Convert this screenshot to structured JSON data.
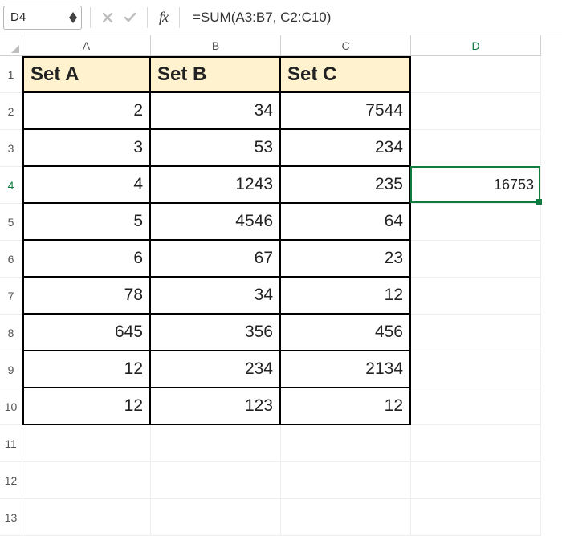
{
  "name_box": {
    "value": "D4"
  },
  "formula_bar": {
    "fx_label": "fx",
    "formula": "=SUM(A3:B7, C2:C10)"
  },
  "columns": [
    "A",
    "B",
    "C",
    "D"
  ],
  "active_col": "D",
  "active_row": "4",
  "rows": [
    "1",
    "2",
    "3",
    "4",
    "5",
    "6",
    "7",
    "8",
    "9",
    "10",
    "11",
    "12",
    "13"
  ],
  "headers": {
    "A": "Set A",
    "B": "Set B",
    "C": "Set C"
  },
  "data": {
    "A": [
      "2",
      "3",
      "4",
      "5",
      "6",
      "78",
      "645",
      "12",
      "12"
    ],
    "B": [
      "34",
      "53",
      "1243",
      "4546",
      "67",
      "34",
      "356",
      "234",
      "123"
    ],
    "C": [
      "7544",
      "234",
      "235",
      "64",
      "23",
      "12",
      "456",
      "2134",
      "12"
    ]
  },
  "d4_value": "16753",
  "selection": {
    "cell": "D4"
  }
}
